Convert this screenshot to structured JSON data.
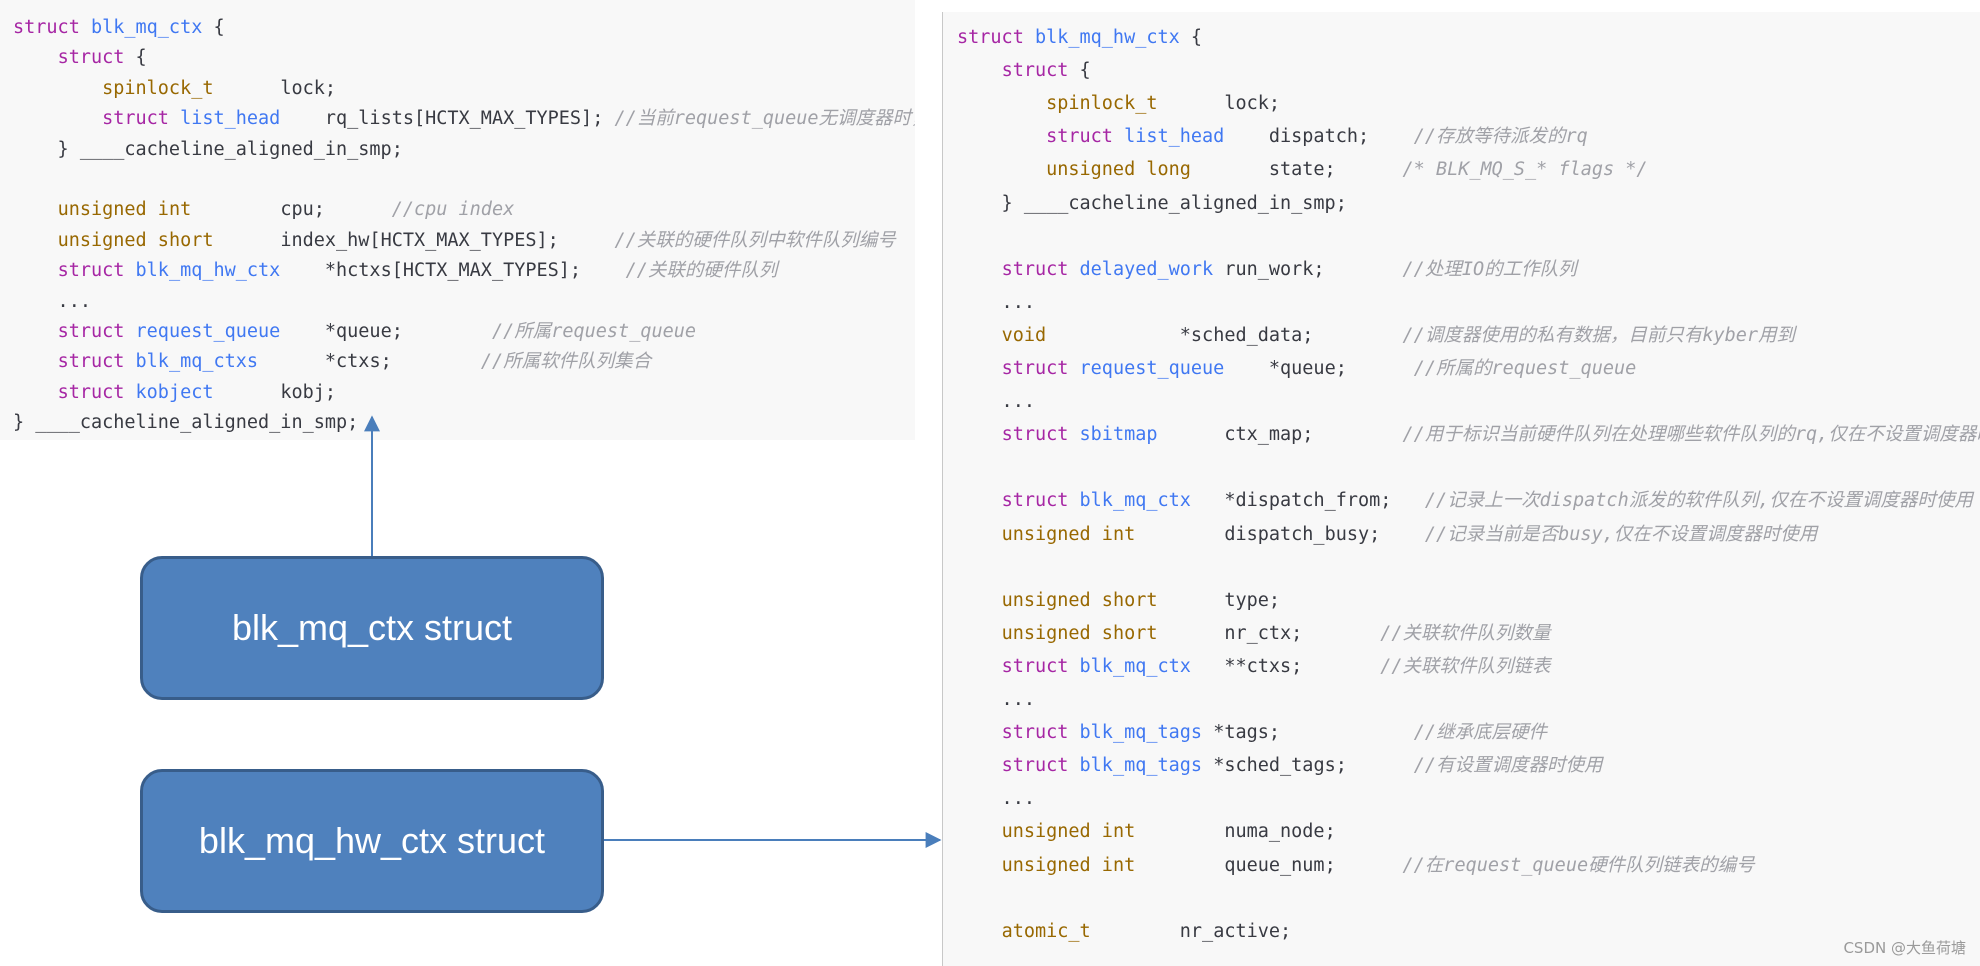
{
  "panels": [
    {
      "id": "left",
      "lines": [
        [
          [
            "kw",
            "struct "
          ],
          [
            "sn",
            "blk_mq_ctx"
          ],
          [
            "tx",
            " {"
          ]
        ],
        [
          [
            "tx",
            "    "
          ],
          [
            "kw",
            "struct"
          ],
          [
            "tx",
            " {"
          ]
        ],
        [
          [
            "tx",
            "        "
          ],
          [
            "ty",
            "spinlock_t"
          ],
          [
            "tx",
            "      lock;"
          ]
        ],
        [
          [
            "tx",
            "        "
          ],
          [
            "kw",
            "struct "
          ],
          [
            "sn",
            "list_head"
          ],
          [
            "tx",
            "    rq_lists[HCTX_MAX_TYPES]; "
          ],
          [
            "cm",
            "//当前request_queue无调度器时，存放等待派发的rq"
          ]
        ],
        [
          [
            "tx",
            "    } ____cacheline_aligned_in_smp;"
          ]
        ],
        [],
        [
          [
            "tx",
            "    "
          ],
          [
            "ty",
            "unsigned int"
          ],
          [
            "tx",
            "        cpu;      "
          ],
          [
            "cm",
            "//cpu index"
          ]
        ],
        [
          [
            "tx",
            "    "
          ],
          [
            "ty",
            "unsigned short"
          ],
          [
            "tx",
            "      index_hw[HCTX_MAX_TYPES];     "
          ],
          [
            "cm",
            "//关联的硬件队列中软件队列编号"
          ]
        ],
        [
          [
            "tx",
            "    "
          ],
          [
            "kw",
            "struct "
          ],
          [
            "sn",
            "blk_mq_hw_ctx"
          ],
          [
            "tx",
            "    *hctxs[HCTX_MAX_TYPES];    "
          ],
          [
            "cm",
            "//关联的硬件队列"
          ]
        ],
        [
          [
            "tx",
            "    ..."
          ]
        ],
        [
          [
            "tx",
            "    "
          ],
          [
            "kw",
            "struct "
          ],
          [
            "sn",
            "request_queue"
          ],
          [
            "tx",
            "    *queue;        "
          ],
          [
            "cm",
            "//所属request_queue"
          ]
        ],
        [
          [
            "tx",
            "    "
          ],
          [
            "kw",
            "struct "
          ],
          [
            "sn",
            "blk_mq_ctxs"
          ],
          [
            "tx",
            "      *ctxs;        "
          ],
          [
            "cm",
            "//所属软件队列集合"
          ]
        ],
        [
          [
            "tx",
            "    "
          ],
          [
            "kw",
            "struct "
          ],
          [
            "sn",
            "kobject"
          ],
          [
            "tx",
            "      kobj;"
          ]
        ],
        [
          [
            "tx",
            "} ____cacheline_aligned_in_smp;"
          ]
        ]
      ]
    },
    {
      "id": "right",
      "lines": [
        [
          [
            "kw",
            "struct "
          ],
          [
            "sn",
            "blk_mq_hw_ctx"
          ],
          [
            "tx",
            " {"
          ]
        ],
        [
          [
            "tx",
            "    "
          ],
          [
            "kw",
            "struct"
          ],
          [
            "tx",
            " {"
          ]
        ],
        [
          [
            "tx",
            "        "
          ],
          [
            "ty",
            "spinlock_t"
          ],
          [
            "tx",
            "      lock;"
          ]
        ],
        [
          [
            "tx",
            "        "
          ],
          [
            "kw",
            "struct "
          ],
          [
            "sn",
            "list_head"
          ],
          [
            "tx",
            "    dispatch;    "
          ],
          [
            "cm",
            "//存放等待派发的rq"
          ]
        ],
        [
          [
            "tx",
            "        "
          ],
          [
            "ty",
            "unsigned long"
          ],
          [
            "tx",
            "       state;      "
          ],
          [
            "cm",
            "/* BLK_MQ_S_* flags */"
          ]
        ],
        [
          [
            "tx",
            "    } ____cacheline_aligned_in_smp;"
          ]
        ],
        [],
        [
          [
            "tx",
            "    "
          ],
          [
            "kw",
            "struct "
          ],
          [
            "sn",
            "delayed_work"
          ],
          [
            "tx",
            " run_work;       "
          ],
          [
            "cm",
            "//处理IO的工作队列"
          ]
        ],
        [
          [
            "tx",
            "    ..."
          ]
        ],
        [
          [
            "tx",
            "    "
          ],
          [
            "ty",
            "void"
          ],
          [
            "tx",
            "            *sched_data;        "
          ],
          [
            "cm",
            "//调度器使用的私有数据，目前只有kyber用到"
          ]
        ],
        [
          [
            "tx",
            "    "
          ],
          [
            "kw",
            "struct "
          ],
          [
            "sn",
            "request_queue"
          ],
          [
            "tx",
            "    *queue;      "
          ],
          [
            "cm",
            "//所属的request_queue"
          ]
        ],
        [
          [
            "tx",
            "    ..."
          ]
        ],
        [
          [
            "tx",
            "    "
          ],
          [
            "kw",
            "struct "
          ],
          [
            "sn",
            "sbitmap"
          ],
          [
            "tx",
            "      ctx_map;        "
          ],
          [
            "cm",
            "//用于标识当前硬件队列在处理哪些软件队列的rq,仅在不设置调度器时使用"
          ]
        ],
        [],
        [
          [
            "tx",
            "    "
          ],
          [
            "kw",
            "struct "
          ],
          [
            "sn",
            "blk_mq_ctx"
          ],
          [
            "tx",
            "   *dispatch_from;   "
          ],
          [
            "cm",
            "//记录上一次dispatch派发的软件队列,仅在不设置调度器时使用"
          ]
        ],
        [
          [
            "tx",
            "    "
          ],
          [
            "ty",
            "unsigned int"
          ],
          [
            "tx",
            "        dispatch_busy;    "
          ],
          [
            "cm",
            "//记录当前是否busy,仅在不设置调度器时使用"
          ]
        ],
        [],
        [
          [
            "tx",
            "    "
          ],
          [
            "ty",
            "unsigned short"
          ],
          [
            "tx",
            "      type;"
          ]
        ],
        [
          [
            "tx",
            "    "
          ],
          [
            "ty",
            "unsigned short"
          ],
          [
            "tx",
            "      nr_ctx;       "
          ],
          [
            "cm",
            "//关联软件队列数量"
          ]
        ],
        [
          [
            "tx",
            "    "
          ],
          [
            "kw",
            "struct "
          ],
          [
            "sn",
            "blk_mq_ctx"
          ],
          [
            "tx",
            "   **ctxs;       "
          ],
          [
            "cm",
            "//关联软件队列链表"
          ]
        ],
        [
          [
            "tx",
            "    ..."
          ]
        ],
        [
          [
            "tx",
            "    "
          ],
          [
            "kw",
            "struct "
          ],
          [
            "sn",
            "blk_mq_tags"
          ],
          [
            "tx",
            " *tags;            "
          ],
          [
            "cm",
            "//继承底层硬件"
          ]
        ],
        [
          [
            "tx",
            "    "
          ],
          [
            "kw",
            "struct "
          ],
          [
            "sn",
            "blk_mq_tags"
          ],
          [
            "tx",
            " *sched_tags;      "
          ],
          [
            "cm",
            "//有设置调度器时使用"
          ]
        ],
        [
          [
            "tx",
            "    ..."
          ]
        ],
        [
          [
            "tx",
            "    "
          ],
          [
            "ty",
            "unsigned int"
          ],
          [
            "tx",
            "        numa_node;"
          ]
        ],
        [
          [
            "tx",
            "    "
          ],
          [
            "ty",
            "unsigned int"
          ],
          [
            "tx",
            "        queue_num;      "
          ],
          [
            "cm",
            "//在request_queue硬件队列链表的编号"
          ]
        ],
        [],
        [
          [
            "tx",
            "    "
          ],
          [
            "ty",
            "atomic_t"
          ],
          [
            "tx",
            "        nr_active;"
          ]
        ],
        [
          [
            "tx",
            "    ..."
          ]
        ]
      ]
    }
  ],
  "boxes": {
    "ctx": "blk_mq_ctx struct",
    "hw": "blk_mq_hw_ctx struct"
  },
  "watermark": "CSDN @大鱼荷塘",
  "colors": {
    "keyword": "#a626a4",
    "type": "#986801",
    "struct_name": "#4078f2",
    "text": "#383a42",
    "comment": "#a0a1a7",
    "box_fill": "#4f81bd",
    "box_border": "#385d8a",
    "arrow": "#4a7ebb"
  }
}
